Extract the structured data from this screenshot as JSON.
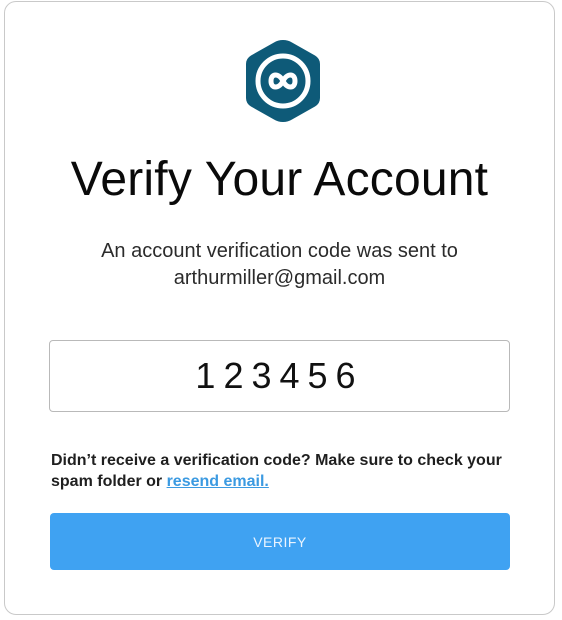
{
  "page": {
    "title": "Verify Your Account",
    "subtitle_line1": "An account verification code was sent to",
    "subtitle_line2": "arthurmiller@gmail.com"
  },
  "code_field": {
    "value": "123456"
  },
  "help": {
    "text": "Didn’t receive a verification code? Make sure to check your spam folder or ",
    "resend_link": "resend email."
  },
  "verify_button": {
    "label": "VERIFY"
  },
  "colors": {
    "brand": "#0e5a78",
    "button": "#3fa2f2",
    "link": "#3b9ae1"
  },
  "icons": {
    "logo": "infinity-hexagon-logo"
  }
}
